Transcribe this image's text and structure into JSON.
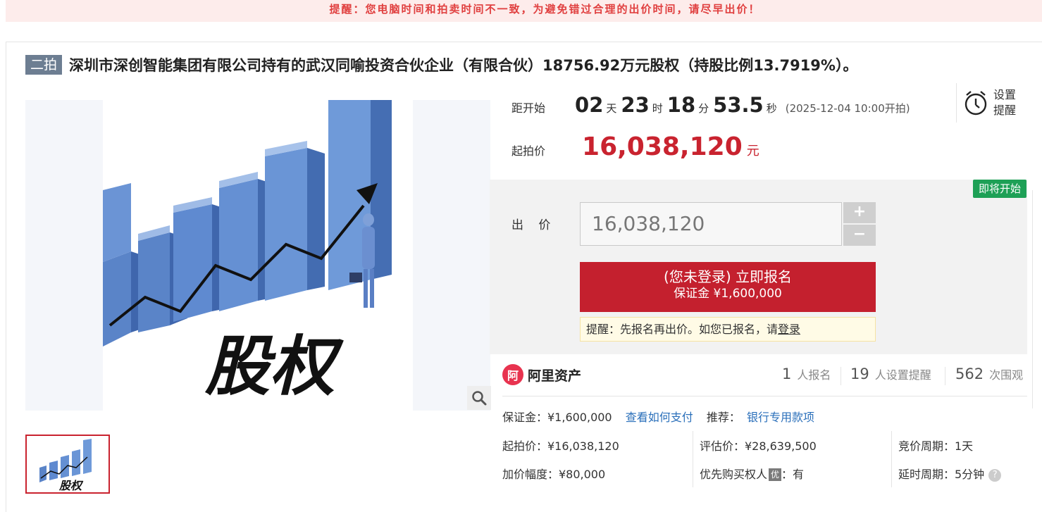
{
  "notice": "提醒：您电脑时间和拍卖时间不一致，为避免错过合理的出价时间，请尽早出价！",
  "auction": {
    "round_tag": "二拍",
    "title": "深圳市深创智能集团有限公司持有的武汉同喻投资合伙企业（有限合伙）18756.92万元股权（持股比例13.7919%）。"
  },
  "image": {
    "caption": "股权"
  },
  "countdown": {
    "label": "距开始",
    "days": "02",
    "days_unit": "天",
    "hours": "23",
    "hours_unit": "时",
    "minutes": "18",
    "minutes_unit": "分",
    "seconds": "53.5",
    "seconds_unit": "秒",
    "start_note": "(2025-12-04 10:00开拍)"
  },
  "reminder": {
    "label": "设置提醒"
  },
  "start_price": {
    "label": "起拍价",
    "value": "16,038,120",
    "unit": "元"
  },
  "bid": {
    "status_badge": "即将开始",
    "label": "出 价",
    "input_value": "16,038,120",
    "increment": "+",
    "decrement": "−",
    "signup_main": "(您未登录) 立即报名",
    "signup_deposit": "保证金 ¥1,600,000",
    "tip_text": "提醒：先报名再出价。如您已报名，请",
    "tip_link": "登录"
  },
  "stats": {
    "brand": "阿里资产",
    "brand_logo": "阿",
    "signups": "1",
    "signups_label": "人报名",
    "reminders": "19",
    "reminders_label": "人设置提醒",
    "views": "562",
    "views_label": "次围观"
  },
  "details": {
    "deposit": "保证金：¥1,600,000",
    "pay_link": "查看如何支付",
    "recommend_label": "推荐：",
    "recommend_link": "银行专用款项",
    "start_price": "起拍价：¥16,038,120",
    "appraisal": "评估价：¥28,639,500",
    "bidding_cycle": "竞价周期：1天",
    "increment": "加价幅度：¥80,000",
    "priority_label": "优先购买权人",
    "priority_badge": "优",
    "priority_value": "：有",
    "delay_cycle": "延时周期：5分钟",
    "help": "?"
  },
  "colors": {
    "accent_red": "#c4202e",
    "notice_bg": "#fdeceb",
    "badge_green": "#1ea056",
    "link_blue": "#2a6fba"
  }
}
